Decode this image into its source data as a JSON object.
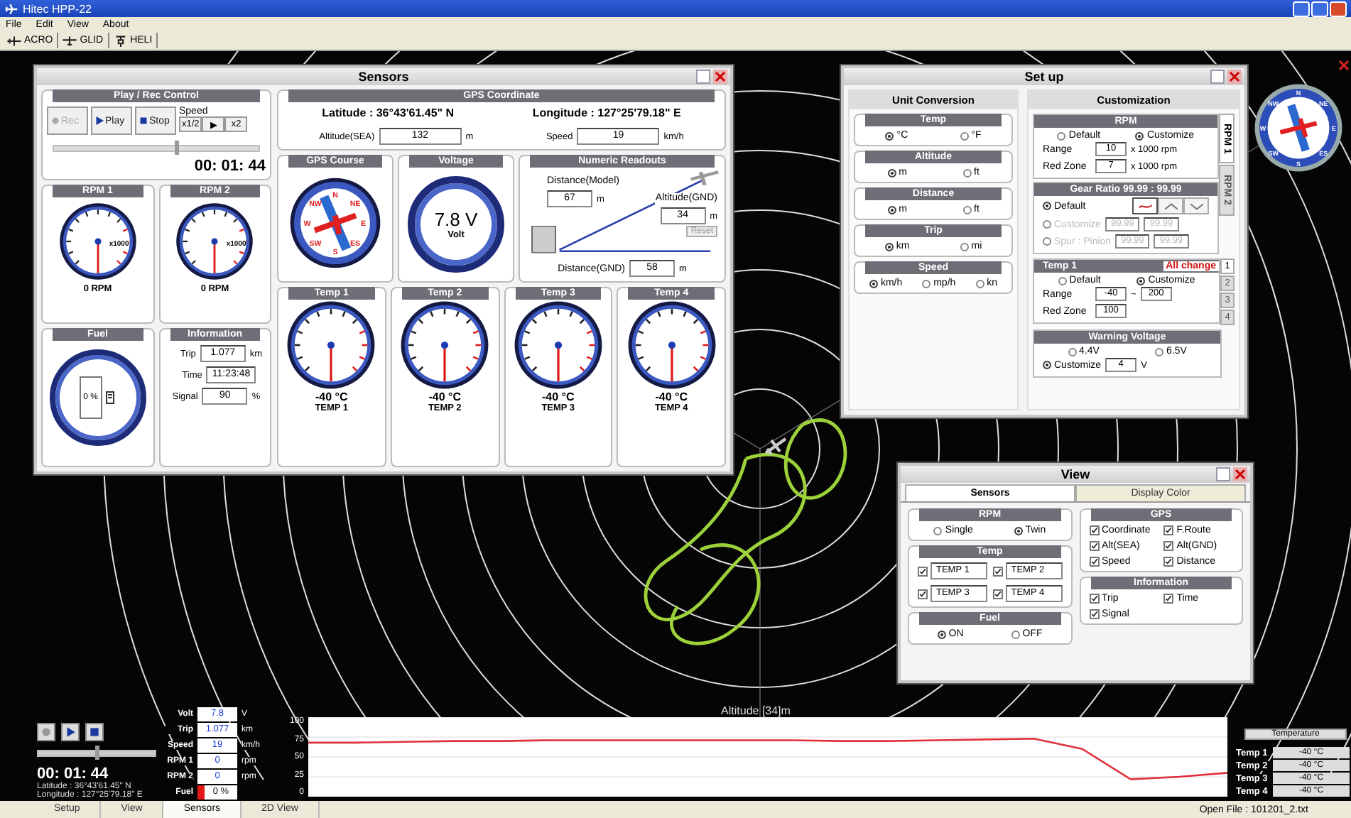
{
  "window": {
    "title": "Hitec HPP-22"
  },
  "menu": [
    "File",
    "Edit",
    "View",
    "About"
  ],
  "toolbar": [
    {
      "label": "ACRO",
      "kind": "plane"
    },
    {
      "label": "GLID",
      "kind": "glider"
    },
    {
      "label": "HELI",
      "kind": "heli"
    }
  ],
  "sensors": {
    "title": "Sensors",
    "playback": {
      "title": "Play / Rec Control",
      "buttons": [
        {
          "label": "Rec",
          "kind": "rec",
          "disabled": true
        },
        {
          "label": "Play",
          "kind": "play",
          "disabled": false
        },
        {
          "label": "Stop",
          "kind": "stop",
          "disabled": false
        }
      ],
      "speed_label": "Speed",
      "speeds": [
        "x1/2",
        "▶",
        "x2"
      ],
      "level": 0.6,
      "time": "00: 01: 44"
    },
    "rpm": [
      {
        "title": "RPM 1",
        "scale": "x1000",
        "reading": "0 RPM"
      },
      {
        "title": "RPM 2",
        "scale": "x1000",
        "reading": "0 RPM"
      }
    ],
    "fuel": {
      "title": "Fuel",
      "reading": "0 %"
    },
    "information": {
      "title": "Information",
      "fields": [
        {
          "label": "Trip",
          "value": "1.077",
          "unit": "km"
        },
        {
          "label": "Time",
          "value": "11:23:48"
        },
        {
          "label": "Signal",
          "value": "90",
          "unit": "%"
        }
      ]
    },
    "gps": {
      "title": "GPS Coordinate",
      "latitude": "Latitude : 36°43'61.45\" N",
      "longitude": "Longitude : 127°25'79.18\" E",
      "fields": [
        {
          "label": "Altitude(SEA)",
          "value": "132",
          "unit": "m"
        },
        {
          "label": "Speed",
          "value": "19",
          "unit": "km/h"
        }
      ]
    },
    "course": {
      "title": "GPS Course",
      "directions": [
        "N",
        "NE",
        "E",
        "ES",
        "S",
        "SW",
        "W",
        "NW"
      ]
    },
    "voltage": {
      "title": "Voltage",
      "value": "7.8 V",
      "unit": "Volt"
    },
    "readouts": {
      "title": "Numeric Readouts",
      "distance_model": {
        "label": "Distance(Model)",
        "value": "67",
        "unit": "m"
      },
      "altitude_gnd": {
        "label": "Altitude(GND)",
        "value": "34",
        "unit": "m"
      },
      "reset": "Reset",
      "distance_gnd": {
        "label": "Distance(GND)",
        "value": "58",
        "unit": "m"
      }
    },
    "temps": [
      {
        "title": "Temp 1",
        "value": "-40 °C",
        "name": "TEMP 1"
      },
      {
        "title": "Temp 2",
        "value": "-40 °C",
        "name": "TEMP 2"
      },
      {
        "title": "Temp 3",
        "value": "-40 °C",
        "name": "TEMP 3"
      },
      {
        "title": "Temp 4",
        "value": "-40 °C",
        "name": "TEMP 4"
      }
    ]
  },
  "setup": {
    "title": "Set up",
    "unit_conversion": {
      "title": "Unit Conversion",
      "groups": [
        {
          "title": "Temp",
          "options": [
            {
              "label": "°C",
              "selected": true
            },
            {
              "label": "°F",
              "selected": false
            }
          ]
        },
        {
          "title": "Altitude",
          "options": [
            {
              "label": "m",
              "selected": true
            },
            {
              "label": "ft",
              "selected": false
            }
          ]
        },
        {
          "title": "Distance",
          "options": [
            {
              "label": "m",
              "selected": true
            },
            {
              "label": "ft",
              "selected": false
            }
          ]
        },
        {
          "title": "Trip",
          "options": [
            {
              "label": "km",
              "selected": true
            },
            {
              "label": "mi",
              "selected": false
            }
          ]
        },
        {
          "title": "Speed",
          "options": [
            {
              "label": "km/h",
              "selected": true
            },
            {
              "label": "mp/h",
              "selected": false
            },
            {
              "label": "kn",
              "selected": false
            }
          ]
        }
      ]
    },
    "customization": {
      "title": "Customization",
      "rpm_tabs": [
        {
          "label": "RPM 1",
          "selected": true
        },
        {
          "label": "RPM 2",
          "selected": false
        }
      ],
      "rpm": {
        "title": "RPM",
        "options": [
          {
            "label": "Default",
            "selected": false
          },
          {
            "label": "Customize",
            "selected": true
          }
        ],
        "range": {
          "label": "Range",
          "value": "10",
          "unit": "x 1000 rpm"
        },
        "red_zone": {
          "label": "Red Zone",
          "value": "7",
          "unit": "x 1000 rpm"
        }
      },
      "gear": {
        "title": "Gear Ratio 99.99 : 99.99",
        "default": {
          "label": "Default",
          "selected": true
        },
        "modes": [
          {
            "selected": true
          },
          {
            "selected": false
          },
          {
            "selected": false
          }
        ],
        "rows": [
          {
            "label": "Customize",
            "selected": false,
            "values": [
              "99.99",
              "99.99"
            ]
          },
          {
            "label": "Spur : Pinion",
            "selected": false,
            "values": [
              "99.99",
              "99.99"
            ]
          }
        ]
      },
      "temp": {
        "title": "Temp 1",
        "all_change": "All change",
        "tabs": [
          {
            "label": "1",
            "selected": true
          },
          {
            "label": "2",
            "selected": false
          },
          {
            "label": "3",
            "selected": false
          },
          {
            "label": "4",
            "selected": false
          }
        ],
        "options": [
          {
            "label": "Default",
            "selected": false
          },
          {
            "label": "Customize",
            "selected": true
          }
        ],
        "range": {
          "label": "Range",
          "min": "-40",
          "separator": "~",
          "max": "200"
        },
        "red_zone": {
          "label": "Red Zone",
          "value": "100"
        }
      },
      "warning": {
        "title": "Warning Voltage",
        "options": [
          {
            "label": "4.4V",
            "selected": false
          },
          {
            "label": "6.5V",
            "selected": false
          }
        ],
        "custom": {
          "label": "Customize",
          "selected": true,
          "value": "4",
          "unit": "V"
        }
      }
    }
  },
  "view": {
    "title": "View",
    "tabs": [
      {
        "label": "Sensors",
        "selected": true
      },
      {
        "label": "Display Color",
        "selected": false
      }
    ],
    "rpm": {
      "title": "RPM",
      "options": [
        {
          "label": "Single",
          "selected": false
        },
        {
          "label": "Twin",
          "selected": true
        }
      ]
    },
    "temp": {
      "title": "Temp",
      "items": [
        {
          "label": "TEMP 1",
          "checked": true
        },
        {
          "label": "TEMP 2",
          "checked": true
        },
        {
          "label": "TEMP 3",
          "checked": true
        },
        {
          "label": "TEMP 4",
          "checked": true
        }
      ]
    },
    "fuel": {
      "title": "Fuel",
      "options": [
        {
          "label": "ON",
          "selected": true
        },
        {
          "label": "OFF",
          "selected": false
        }
      ]
    },
    "gps": {
      "title": "GPS",
      "items": [
        {
          "label": "Coordinate",
          "checked": true
        },
        {
          "label": "F.Route",
          "checked": true
        },
        {
          "label": "Alt(SEA)",
          "checked": true
        },
        {
          "label": "Alt(GND)",
          "checked": true
        },
        {
          "label": "Speed",
          "checked": true
        },
        {
          "label": "Distance",
          "checked": true
        }
      ]
    },
    "information": {
      "title": "Information",
      "items": [
        {
          "label": "Trip",
          "checked": true
        },
        {
          "label": "Time",
          "checked": true
        },
        {
          "label": "Signal",
          "checked": true
        }
      ]
    }
  },
  "compass_overlay": {
    "directions": [
      "N",
      "NE",
      "E",
      "ES",
      "S",
      "SW",
      "W",
      "NW"
    ]
  },
  "player": {
    "level": 0.5,
    "time": "00: 01: 44",
    "latitude": "Latitude : 36°43'61.45\" N",
    "longitude": "Longitude : 127°25'79.18\" E"
  },
  "readings": [
    {
      "label": "Volt",
      "value": "7.8",
      "unit": "V",
      "kind": "value"
    },
    {
      "label": "Trip",
      "value": "1.077",
      "unit": "km",
      "kind": "value"
    },
    {
      "label": "Speed",
      "value": "19",
      "unit": "km/h",
      "kind": "value"
    },
    {
      "label": "RPM 1",
      "value": "0",
      "unit": "rpm",
      "kind": "value"
    },
    {
      "label": "RPM 2",
      "value": "0",
      "unit": "rpm",
      "kind": "value"
    },
    {
      "label": "Fuel",
      "value": "0 %",
      "kind": "fuel"
    }
  ],
  "altitude_chart": {
    "chart_data": {
      "type": "line",
      "title": "Altitude [34]m",
      "ylim": [
        0,
        100
      ],
      "yticks": [
        0,
        25,
        50,
        75,
        100
      ],
      "grid": true,
      "series": [
        {
          "color": "#e0303a",
          "values": [
            68,
            68,
            69,
            70,
            70,
            71,
            71,
            71,
            71,
            71,
            71,
            70,
            70,
            71,
            72,
            73,
            60,
            22,
            25,
            30
          ]
        }
      ]
    }
  },
  "temperature_panel": {
    "title": "Temperature",
    "rows": [
      {
        "label": "Temp 1",
        "value": "-40 °C"
      },
      {
        "label": "Temp 2",
        "value": "-40 °C"
      },
      {
        "label": "Temp 3",
        "value": "-40 °C"
      },
      {
        "label": "Temp 4",
        "value": "-40 °C"
      }
    ]
  },
  "bottom_tabs": [
    {
      "label": "Setup",
      "selected": false
    },
    {
      "label": "View",
      "selected": false
    },
    {
      "label": "Sensors",
      "selected": true
    },
    {
      "label": "2D View",
      "selected": false
    }
  ],
  "status": "Open File : 101201_2.txt"
}
